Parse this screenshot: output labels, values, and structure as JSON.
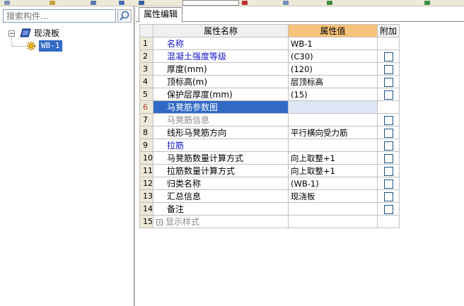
{
  "colors": {
    "header_value_bg": "#f7c27a",
    "selection": "#316ac5",
    "link_blue": "#1414c8"
  },
  "search": {
    "placeholder": "搜索构件..."
  },
  "tree": {
    "root_label": "现浇板",
    "child_label": "WB-1"
  },
  "tab": {
    "label": "属性编辑"
  },
  "grid": {
    "headers": {
      "name": "属性名称",
      "value": "属性值",
      "extra": "附加"
    },
    "rows": [
      {
        "num": "1",
        "name": "名称",
        "value": "WB-1",
        "style": "blue",
        "checkbox": false
      },
      {
        "num": "2",
        "name": "混凝土强度等级",
        "value": "(C30)",
        "style": "blue",
        "checkbox": true
      },
      {
        "num": "3",
        "name": "厚度(mm)",
        "value": "(120)",
        "style": "normal",
        "checkbox": true
      },
      {
        "num": "4",
        "name": "顶标高(m)",
        "value": "层顶标高",
        "style": "normal",
        "checkbox": true
      },
      {
        "num": "5",
        "name": "保护层厚度(mm)",
        "value": "(15)",
        "style": "normal",
        "checkbox": true
      },
      {
        "num": "6",
        "name": "马凳筋参数图",
        "value": "",
        "style": "selected",
        "checkbox": false
      },
      {
        "num": "7",
        "name": "马凳筋信息",
        "value": "",
        "style": "gray",
        "checkbox": true
      },
      {
        "num": "8",
        "name": "线形马凳筋方向",
        "value": "平行横向受力筋",
        "style": "normal",
        "checkbox": true
      },
      {
        "num": "9",
        "name": "拉筋",
        "value": "",
        "style": "blue",
        "checkbox": true
      },
      {
        "num": "10",
        "name": "马凳筋数量计算方式",
        "value": "向上取整+1",
        "style": "normal",
        "checkbox": true
      },
      {
        "num": "11",
        "name": "拉筋数量计算方式",
        "value": "向上取整+1",
        "style": "normal",
        "checkbox": true
      },
      {
        "num": "12",
        "name": "归类名称",
        "value": "(WB-1)",
        "style": "normal",
        "checkbox": true
      },
      {
        "num": "13",
        "name": "汇总信息",
        "value": "现浇板",
        "style": "normal",
        "checkbox": true
      },
      {
        "num": "14",
        "name": "备注",
        "value": "",
        "style": "normal",
        "checkbox": true
      },
      {
        "num": "15",
        "name": "显示样式",
        "value": "",
        "style": "gray-expand",
        "checkbox": false,
        "expander": "+"
      }
    ]
  }
}
